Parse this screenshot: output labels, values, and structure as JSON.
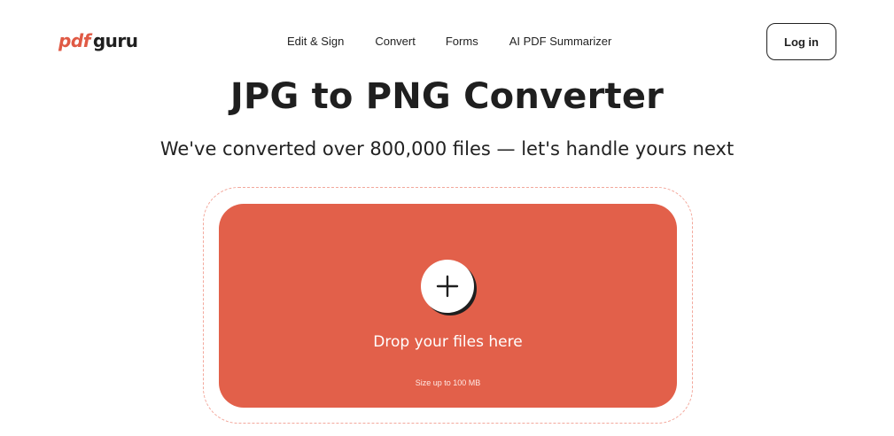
{
  "header": {
    "logo": {
      "part1": "pdf",
      "part2": "guru"
    },
    "nav": [
      {
        "label": "Edit & Sign"
      },
      {
        "label": "Convert"
      },
      {
        "label": "Forms"
      },
      {
        "label": "AI PDF Summarizer"
      }
    ],
    "login_label": "Log in"
  },
  "hero": {
    "title": "JPG to PNG Converter",
    "subtitle": "We've converted over 800,000 files — let's handle yours next"
  },
  "dropzone": {
    "icon": "plus-icon",
    "label": "Drop your files here",
    "size_note": "Size up to 100 MB"
  },
  "colors": {
    "accent": "#e2604a",
    "text": "#1f1f1f",
    "dashed_border": "#f3a89c"
  }
}
